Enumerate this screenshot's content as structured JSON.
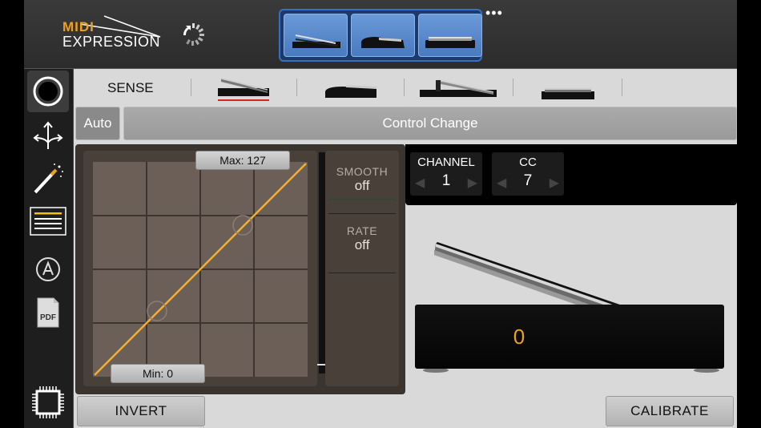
{
  "header": {
    "logo_line1": "MIDI",
    "logo_line2": "EXPRESSION",
    "more_label": "•••",
    "pedal_types": [
      "expression-pedal",
      "sustain-pedal",
      "switch-pedal"
    ]
  },
  "sidebar": {
    "items": [
      {
        "icon": "record-icon",
        "active": true
      },
      {
        "icon": "routing-arrows-icon"
      },
      {
        "icon": "magic-wand-icon"
      },
      {
        "icon": "list-icon",
        "highlight": "#f0c020"
      },
      {
        "icon": "a-circle-icon"
      },
      {
        "icon": "pdf-icon",
        "text": "PDF"
      },
      {
        "icon": "chip-icon"
      }
    ]
  },
  "tabs": {
    "sense_label": "SENSE",
    "items": [
      "expression-pedal",
      "sustain-pedal",
      "expression-pedal-alt",
      "switch-pedal"
    ],
    "active_index": 0
  },
  "mode": {
    "auto_label": "Auto",
    "type_label": "Control Change"
  },
  "curve": {
    "max_label": "Max: 127",
    "min_label": "Min: 0",
    "line_color": "#f0b030"
  },
  "params": {
    "smooth_label": "SMOOTH",
    "smooth_value": "off",
    "rate_label": "RATE",
    "rate_value": "off"
  },
  "midi": {
    "channel_label": "CHANNEL",
    "channel_value": "1",
    "cc_label": "CC",
    "cc_value": "7"
  },
  "pedal": {
    "value": "0",
    "value_color": "#f0a020"
  },
  "bottom": {
    "invert_label": "INVERT",
    "calibrate_label": "CALIBRATE"
  }
}
